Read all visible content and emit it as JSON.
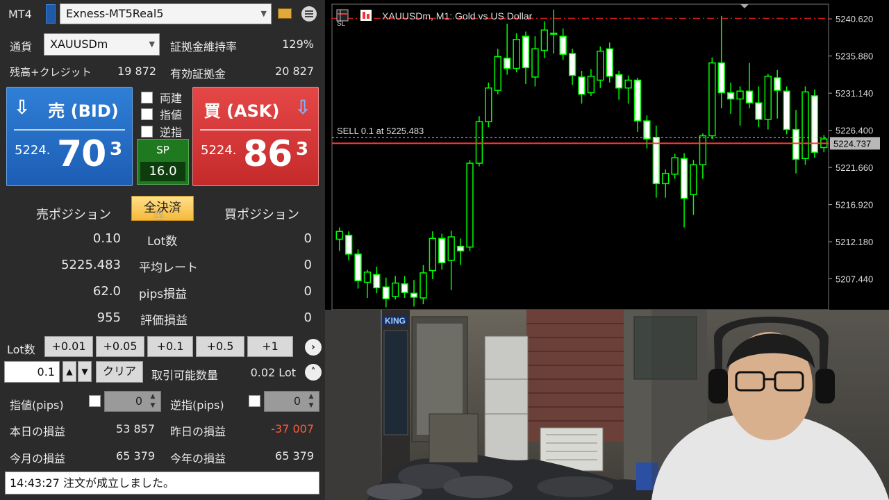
{
  "panel": {
    "app_label": "MT4",
    "account": "Exness-MT5Real5",
    "currency_label": "通貨",
    "symbol": "XAUUSDm",
    "margin_level_label": "証拠金維持率",
    "margin_level": "129%",
    "balance_label": "残高+クレジット",
    "balance": "19 872",
    "equity_label": "有効証拠金",
    "equity": "20 827",
    "bid": {
      "title": "売 (BID)",
      "prefix": "5224.",
      "big": "70",
      "sup": "3"
    },
    "ask": {
      "title": "買 (ASK)",
      "prefix": "5224.",
      "big": "86",
      "sup": "3"
    },
    "options": [
      "両建",
      "指値",
      "逆指"
    ],
    "spread_label": "SP",
    "spread": "16.0",
    "sell_position_label": "売ポジション",
    "close_all_label": "全決済",
    "buy_position_label": "買ポジション",
    "position_rows": [
      {
        "sell": "0.10",
        "label": "Lot数",
        "buy": "0"
      },
      {
        "sell": "5225.483",
        "label": "平均レート",
        "buy": "0"
      },
      {
        "sell": "62.0",
        "label": "pips損益",
        "buy": "0"
      },
      {
        "sell": "955",
        "label": "評価損益",
        "buy": "0"
      }
    ],
    "lot_label": "Lot数",
    "lot_buttons": [
      "+0.01",
      "+0.05",
      "+0.1",
      "+0.5",
      "+1"
    ],
    "lot_value": "0.1",
    "clear_label": "クリア",
    "tradable_label": "取引可能数量",
    "tradable_value": "0.02 Lot",
    "limit_label": "指値(pips)",
    "limit_value": "0",
    "stop_label": "逆指(pips)",
    "stop_value": "0",
    "today_pl_label": "本日の損益",
    "today_pl": "53 857",
    "yesterday_pl_label": "昨日の損益",
    "yesterday_pl": "-37 007",
    "month_pl_label": "今月の損益",
    "month_pl": "65 379",
    "year_pl_label": "今年の損益",
    "year_pl": "65 379",
    "status_message": "14:43:27 注文が成立しました。",
    "colors": {
      "bid": "#1d5db4",
      "ask": "#c52a2a",
      "loss": "#ff5a3a",
      "close_all": "#f5b93a"
    }
  },
  "chart": {
    "title": "XAUUSDm, M1:  Gold vs US Dollar",
    "sl_marker": "SL",
    "order_label": "SELL 0.1 at 5225.483",
    "current_price_label": "5224.737",
    "price_ticks": [
      "5240.620",
      "5235.880",
      "5231.140",
      "5226.400",
      "5221.660",
      "5216.920",
      "5212.180",
      "5207.440"
    ],
    "colors": {
      "bull": "#00ff00",
      "sl_line": "#ff2020",
      "price_line": "#ff3b3b"
    }
  },
  "chart_data": {
    "type": "candlestick",
    "series_name": "XAUUSDm M1",
    "y_range": [
      5203.5,
      5242.5
    ],
    "price_ticks": [
      5240.62,
      5235.88,
      5231.14,
      5226.4,
      5221.66,
      5216.92,
      5212.18,
      5207.44
    ],
    "stop_loss": 5240.7,
    "sell_entry": 5225.483,
    "current_price": 5224.737,
    "candles": [
      [
        5212.5,
        5214.0,
        5211.0,
        5213.5
      ],
      [
        5213.0,
        5213.5,
        5209.8,
        5210.6
      ],
      [
        5210.6,
        5211.2,
        5206.2,
        5207.2
      ],
      [
        5207.0,
        5208.6,
        5205.0,
        5208.3
      ],
      [
        5208.0,
        5209.0,
        5205.6,
        5206.3
      ],
      [
        5206.4,
        5207.6,
        5203.8,
        5204.9
      ],
      [
        5205.2,
        5207.8,
        5204.8,
        5206.9
      ],
      [
        5206.8,
        5207.8,
        5205.0,
        5205.7
      ],
      [
        5205.6,
        5207.3,
        5203.9,
        5205.1
      ],
      [
        5205.0,
        5209.2,
        5204.2,
        5208.2
      ],
      [
        5208.5,
        5213.5,
        5207.4,
        5212.6
      ],
      [
        5212.6,
        5213.2,
        5208.6,
        5209.5
      ],
      [
        5209.8,
        5213.6,
        5206.0,
        5212.8
      ],
      [
        5211.6,
        5212.6,
        5209.2,
        5211.0
      ],
      [
        5211.5,
        5222.6,
        5211.0,
        5222.2
      ],
      [
        5222.2,
        5228.2,
        5221.8,
        5227.5
      ],
      [
        5227.5,
        5232.5,
        5226.8,
        5231.8
      ],
      [
        5231.5,
        5236.8,
        5231.0,
        5235.8
      ],
      [
        5235.6,
        5240.0,
        5233.5,
        5234.3
      ],
      [
        5234.3,
        5238.8,
        5233.8,
        5238.0
      ],
      [
        5238.4,
        5239.0,
        5232.3,
        5234.4
      ],
      [
        5233.2,
        5238.4,
        5232.0,
        5236.8
      ],
      [
        5236.6,
        5240.3,
        5235.6,
        5239.2
      ],
      [
        5238.8,
        5241.8,
        5236.2,
        5238.7
      ],
      [
        5238.4,
        5239.4,
        5235.4,
        5236.1
      ],
      [
        5236.2,
        5236.8,
        5232.2,
        5233.4
      ],
      [
        5233.2,
        5234.0,
        5229.8,
        5231.0
      ],
      [
        5231.2,
        5234.2,
        5230.8,
        5233.3
      ],
      [
        5232.8,
        5237.1,
        5231.8,
        5236.5
      ],
      [
        5236.8,
        5237.6,
        5232.5,
        5233.3
      ],
      [
        5233.5,
        5234.0,
        5230.3,
        5231.8
      ],
      [
        5231.8,
        5233.4,
        5229.8,
        5232.8
      ],
      [
        5232.8,
        5233.1,
        5226.2,
        5227.6
      ],
      [
        5227.6,
        5228.3,
        5224.1,
        5225.3
      ],
      [
        5225.5,
        5227.0,
        5217.8,
        5219.6
      ],
      [
        5219.6,
        5221.4,
        5217.8,
        5220.9
      ],
      [
        5220.8,
        5223.4,
        5220.2,
        5222.9
      ],
      [
        5222.8,
        5223.5,
        5214.0,
        5217.7
      ],
      [
        5218.2,
        5222.6,
        5215.6,
        5222.0
      ],
      [
        5222.0,
        5226.0,
        5220.2,
        5225.7
      ],
      [
        5225.7,
        5235.7,
        5225.3,
        5235.0
      ],
      [
        5235.0,
        5241.0,
        5229.2,
        5231.2
      ],
      [
        5231.2,
        5232.5,
        5228.5,
        5230.4
      ],
      [
        5230.4,
        5232.0,
        5227.0,
        5231.4
      ],
      [
        5231.4,
        5235.0,
        5229.2,
        5229.9
      ],
      [
        5229.9,
        5232.0,
        5226.8,
        5227.8
      ],
      [
        5227.8,
        5233.6,
        5226.5,
        5233.3
      ],
      [
        5233.1,
        5234.1,
        5227.9,
        5231.5
      ],
      [
        5231.4,
        5232.0,
        5225.9,
        5226.5
      ],
      [
        5226.5,
        5229.0,
        5220.9,
        5222.7
      ],
      [
        5222.8,
        5232.0,
        5222.0,
        5231.3
      ],
      [
        5230.8,
        5231.6,
        5222.9,
        5223.6
      ],
      [
        5224.2,
        5225.8,
        5223.6,
        5225.3
      ]
    ]
  },
  "scene": {
    "shop_sign": "KING"
  }
}
